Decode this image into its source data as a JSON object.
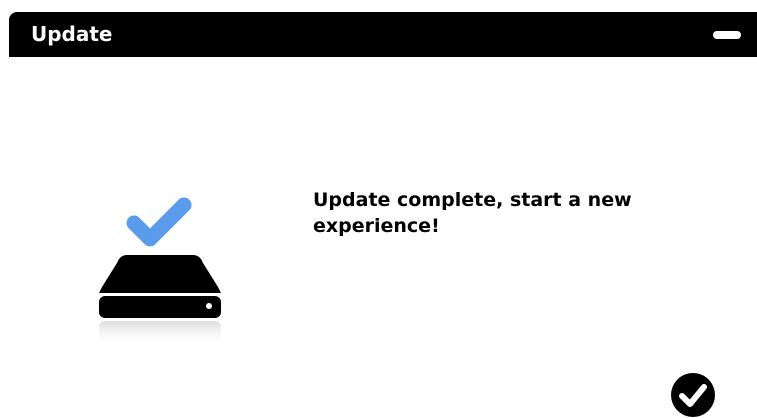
{
  "window": {
    "title": "Update"
  },
  "titlebar": {
    "minimize_icon": "minimize-icon"
  },
  "content": {
    "illustration_icon": "drive-check-icon",
    "checkmark_color": "#5b9bec",
    "message": "Update complete, start a new experience!"
  },
  "footer": {
    "confirm_icon": "check-circle-icon"
  }
}
